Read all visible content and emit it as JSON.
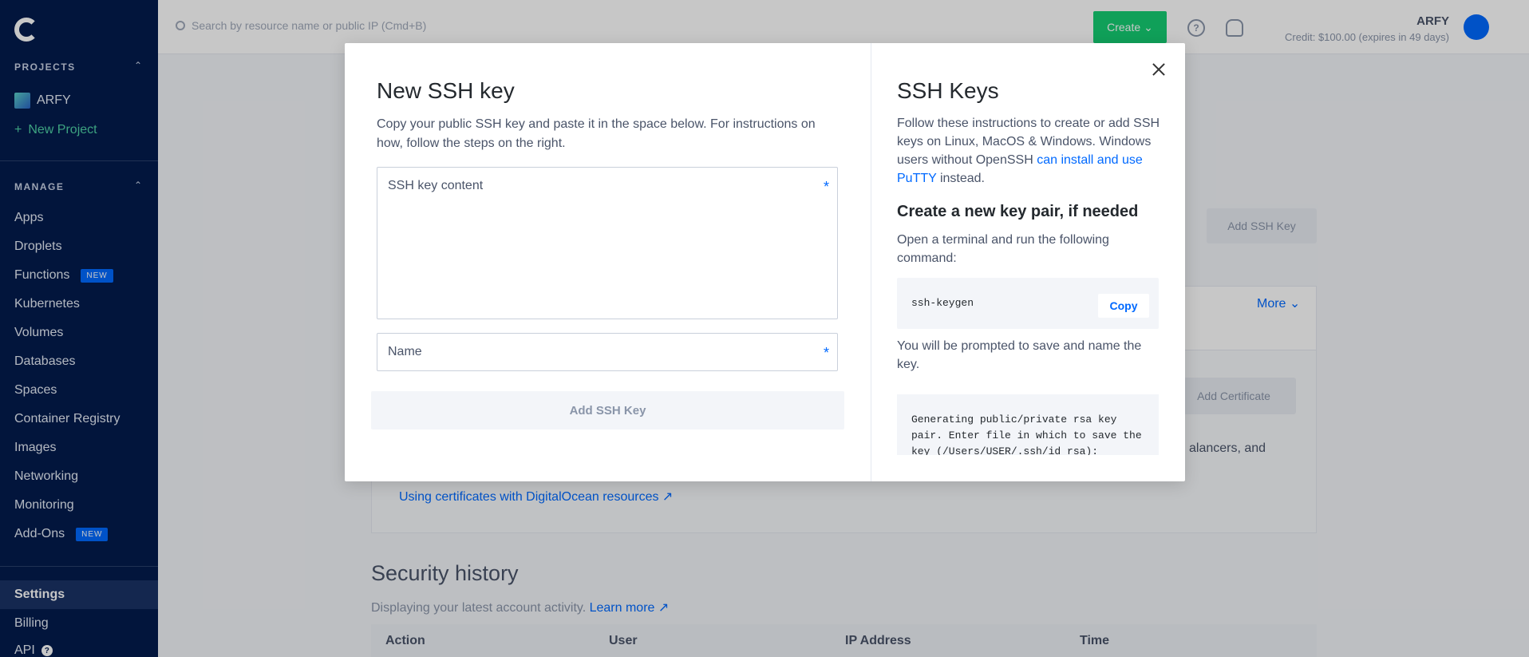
{
  "sidebar": {
    "projects_header": "PROJECTS",
    "project_name": "ARFY",
    "new_project": "New Project",
    "manage_header": "MANAGE",
    "items": [
      "Apps",
      "Droplets",
      "Functions",
      "Kubernetes",
      "Volumes",
      "Databases",
      "Spaces",
      "Container Registry",
      "Images",
      "Networking",
      "Monitoring",
      "Add-Ons"
    ],
    "new_badge": "NEW",
    "settings": "Settings",
    "billing": "Billing",
    "api": "API"
  },
  "topbar": {
    "search_placeholder": "Search by resource name or public IP (Cmd+B)",
    "create_label": "Create",
    "help_icon": "?",
    "account_name": "ARFY",
    "credit": "Credit: $100.00 (expires in 49 days)"
  },
  "background": {
    "add_ssh_key": "Add SSH Key",
    "more": "More",
    "add_certificate": "Add Certificate",
    "lancers_text": "alancers, and",
    "certs_link": "Using certificates with DigitalOcean resources",
    "security_history": "Security history",
    "security_sub": "Displaying your latest account activity.",
    "learn_more": "Learn more",
    "columns": [
      "Action",
      "User",
      "IP Address",
      "Time"
    ]
  },
  "modal": {
    "title": "New SSH key",
    "description": "Copy your public SSH key and paste it in the space below. For instructions on how, follow the steps on the right.",
    "key_content_label": "SSH key content",
    "name_label": "Name",
    "required_mark": "*",
    "add_button": "Add SSH Key"
  },
  "help_panel": {
    "title": "SSH Keys",
    "intro": "Follow these instructions to create or add SSH keys on Linux, MacOS & Windows. Windows users without OpenSSH",
    "putty_link": "can install and use PuTTY",
    "intro_end": "instead.",
    "create_heading": "Create a new key pair, if needed",
    "terminal_text": "Open a terminal and run the following command:",
    "command": "ssh-keygen",
    "copy_label": "Copy",
    "prompt_text": "You will be prompted to save and name the key.",
    "output": "Generating public/private rsa key pair. Enter file in which to save the key (/Users/USER/.ssh/id_rsa):"
  }
}
